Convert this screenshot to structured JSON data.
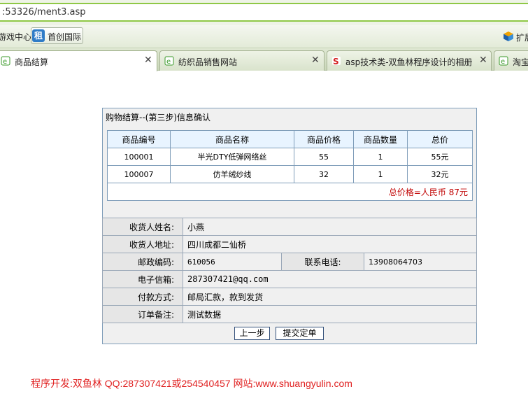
{
  "browser": {
    "address": ":53326/ment3.asp",
    "favorites": [
      {
        "label": "游戏中心"
      },
      {
        "label": "首创国际",
        "badge": "租"
      }
    ],
    "extension_label": "扩展",
    "tabs": [
      {
        "title": "商品结算",
        "active": true
      },
      {
        "title": "纺织品销售网站",
        "active": false
      },
      {
        "title": "asp技术类-双鱼林程序设计的相册",
        "active": false
      },
      {
        "title": "淘宝",
        "active": false
      }
    ]
  },
  "panel": {
    "title": "购物结算--(第三步)信息确认",
    "columns": [
      "商品编号",
      "商品名称",
      "商品价格",
      "商品数量",
      "总价"
    ],
    "rows": [
      {
        "id": "100001",
        "name": "半光DTY低弹网络丝",
        "price": "55",
        "qty": "1",
        "total": "55元"
      },
      {
        "id": "100007",
        "name": "仿羊绒纱线",
        "price": "32",
        "qty": "1",
        "total": "32元"
      }
    ],
    "grand_total": "总价格=人民币 87元",
    "receiver_name_label": "收货人姓名:",
    "receiver_name": "小燕",
    "receiver_addr_label": "收货人地址:",
    "receiver_addr": "四川成都二仙桥",
    "postcode_label": "邮政编码:",
    "postcode": "610056",
    "phone_label": "联系电话:",
    "phone": "13908064703",
    "email_label": "电子信箱:",
    "email": "287307421@qq.com",
    "payment_label": "付款方式:",
    "payment": "邮局汇款，款到发货",
    "note_label": "订单备注:",
    "note": "测试数据",
    "prev_button": "上一步",
    "submit_button": "提交定单"
  },
  "footer": "程序开发:双鱼林 QQ:287307421或254540457 网站:www.shuangyulin.com",
  "colors": {
    "accent_green": "#8fc846",
    "table_border": "#7f9db9",
    "total_red": "#c00000",
    "footer_red": "#e02020"
  }
}
